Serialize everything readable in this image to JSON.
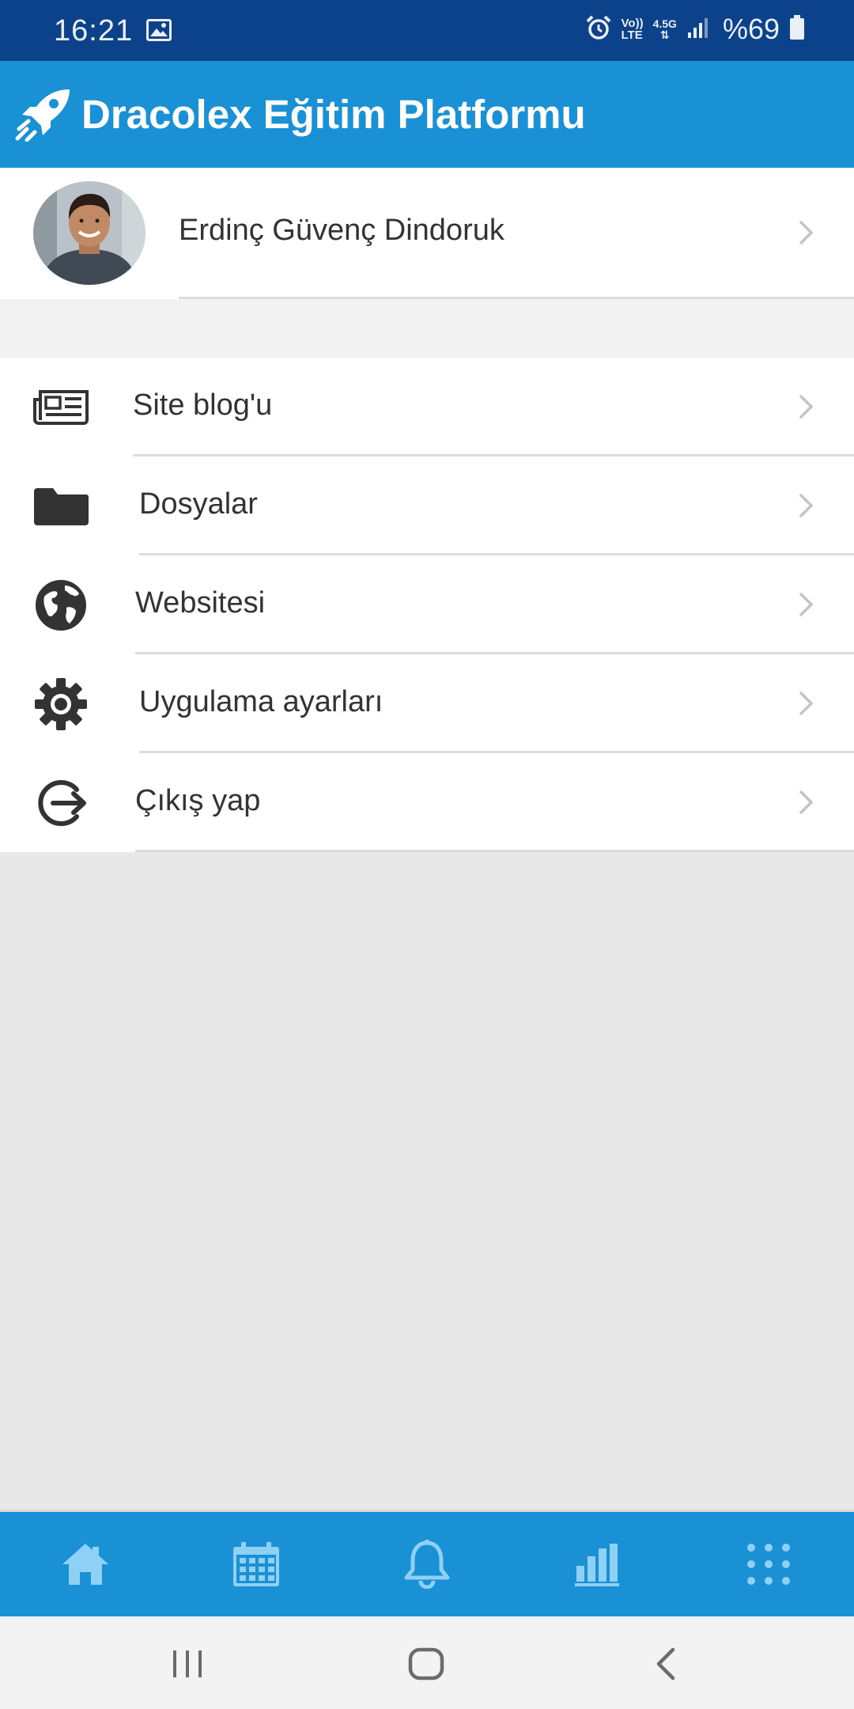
{
  "status_bar": {
    "time": "16:21",
    "network_label_top": "Vo))",
    "network_label_bottom": "LTE",
    "data_type": "4.5G",
    "battery": "%69"
  },
  "app_bar": {
    "title": "Dracolex Eğitim Platformu",
    "logo_icon": "rocket-icon"
  },
  "profile": {
    "name": "Erdinç Güvenç Dindoruk"
  },
  "menu": {
    "items": [
      {
        "label": "Site blog'u",
        "icon": "newspaper-icon"
      },
      {
        "label": "Dosyalar",
        "icon": "folder-icon"
      },
      {
        "label": "Websitesi",
        "icon": "globe-icon"
      },
      {
        "label": "Uygulama ayarları",
        "icon": "gear-icon"
      },
      {
        "label": "Çıkış yap",
        "icon": "sign-out-icon"
      }
    ]
  },
  "bottom_nav": {
    "items": [
      {
        "icon": "home-icon"
      },
      {
        "icon": "calendar-icon"
      },
      {
        "icon": "bell-icon"
      },
      {
        "icon": "bar-chart-icon"
      },
      {
        "icon": "grid-dots-icon"
      }
    ]
  },
  "colors": {
    "status_bar_bg": "#0b4289",
    "app_bar_bg": "#1991d4",
    "nav_icon": "#8fd0f5",
    "text": "#333333",
    "icon_dark": "#333333",
    "page_bg": "#e8e8e8"
  }
}
